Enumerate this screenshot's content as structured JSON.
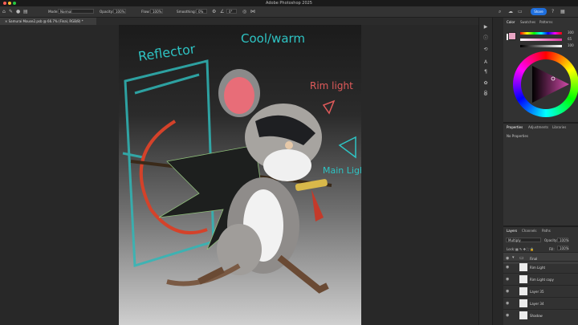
{
  "window": {
    "title": "Adobe Photoshop 2025"
  },
  "options_bar": {
    "mode_label": "Mode:",
    "mode_value": "Normal",
    "opacity_label": "Opacity:",
    "opacity_value": "100%",
    "flow_label": "Flow:",
    "flow_value": "100%",
    "smoothing_label": "Smoothing:",
    "smoothing_value": "0%",
    "angle_value": "0°",
    "share_label": "Share"
  },
  "document_tab": {
    "label": "Samurai Mouse2.psb @ 66.7% (Final, RGB/8) *"
  },
  "art_annotations": {
    "reflector": "Reflector",
    "cool_warm": "Cool/warm",
    "rim_light": "Rim light",
    "main_light": "Main Light"
  },
  "color_panel": {
    "tabs": [
      "Color",
      "Swatches",
      "Patterns"
    ],
    "foreground": "#e8a6c4",
    "background": "#ffffff",
    "slider_values": [
      "300",
      "65",
      "100"
    ]
  },
  "properties_panel": {
    "tabs": [
      "Properties",
      "Adjustments",
      "Libraries"
    ],
    "empty_text": "No Properties"
  },
  "layers_panel": {
    "tabs": [
      "Layers",
      "Channels",
      "Paths"
    ],
    "blend_mode": "Multiply",
    "opacity_label": "Opacity:",
    "opacity_value": "100%",
    "lock_label": "Lock:",
    "fill_label": "Fill:",
    "fill_value": "100%",
    "layers": [
      {
        "name": "Final"
      },
      {
        "name": "Rim Light"
      },
      {
        "name": "Rim Light copy"
      },
      {
        "name": "Layer 35"
      },
      {
        "name": "Layer 34"
      },
      {
        "name": "Shadow"
      }
    ]
  },
  "colors": {
    "accent": "#1f6fde",
    "annotation_teal": "#2ec4c4",
    "annotation_red": "#e05a5a"
  }
}
